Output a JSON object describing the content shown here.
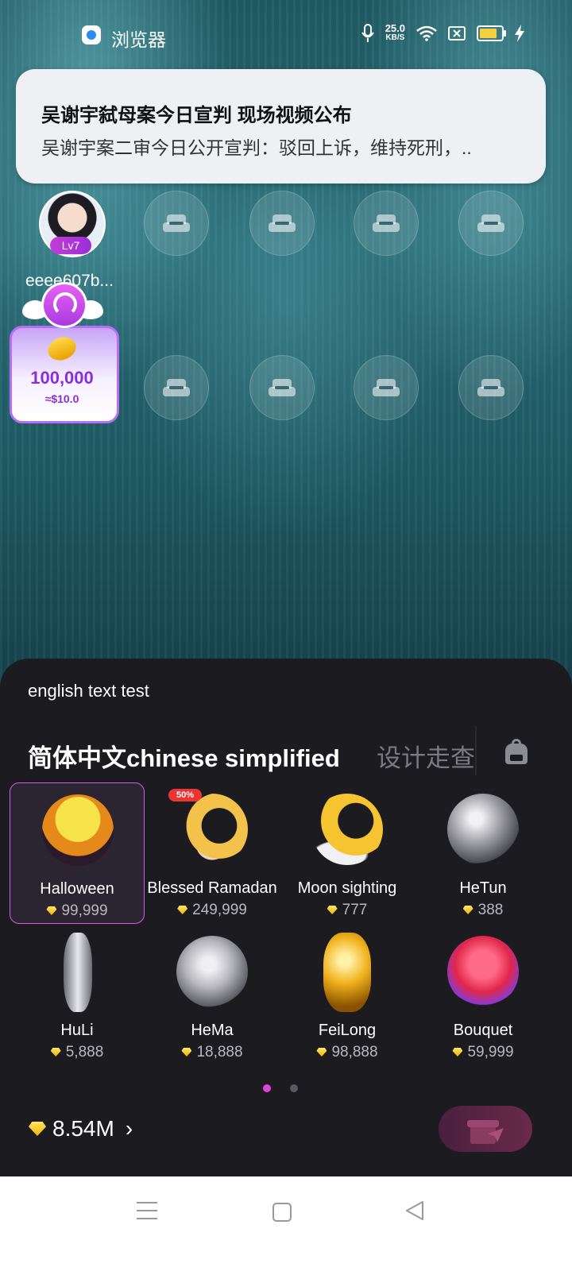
{
  "status_bar": {
    "app_name": "浏览器",
    "speed_value": "25.0",
    "speed_unit": "KB/S",
    "icons": [
      "mic-icon",
      "wifi-icon",
      "sim-off-icon",
      "battery-icon",
      "charging-icon"
    ]
  },
  "notification": {
    "title": "吴谢宇弑母案今日宣判 现场视频公布",
    "body": "吴谢宇案二审今日公开宣判：驳回上诉，维持死刑，.."
  },
  "room": {
    "host": {
      "name": "eeee607b...",
      "level": "Lv7"
    },
    "empty_seat_icon": "sofa-icon",
    "coin_card": {
      "amount": "100,000",
      "usd": "≈$10.0"
    }
  },
  "gift_panel": {
    "test_text": "english text test",
    "tabs": [
      {
        "label": "简体中文chinese simplified",
        "active": true
      },
      {
        "label": "设计走查",
        "active": false
      }
    ],
    "gifts": [
      {
        "name": "Halloween",
        "price": "99,999",
        "selected": true,
        "icon": "pumpkin-icon"
      },
      {
        "name": "Blessed Ramadan",
        "price": "249,999",
        "badge": "50%",
        "icon": "ramadan-moon-icon"
      },
      {
        "name": "Moon sighting",
        "price": "777",
        "icon": "moon-star-icon"
      },
      {
        "name": "HeTun",
        "price": "388",
        "icon": "pufferfish-icon"
      },
      {
        "name": "HuLi",
        "price": "5,888",
        "icon": "fox-statue-icon"
      },
      {
        "name": "HeMa",
        "price": "18,888",
        "icon": "hippo-statue-icon"
      },
      {
        "name": "FeiLong",
        "price": "98,888",
        "icon": "golden-dragon-icon"
      },
      {
        "name": "Bouquet",
        "price": "59,999",
        "icon": "rose-bouquet-icon"
      }
    ],
    "page_indicator": {
      "pages": 2,
      "current": 1
    },
    "balance": "8.54M",
    "colors": {
      "accent": "#d65af0",
      "diamond": "#f5c518"
    }
  }
}
